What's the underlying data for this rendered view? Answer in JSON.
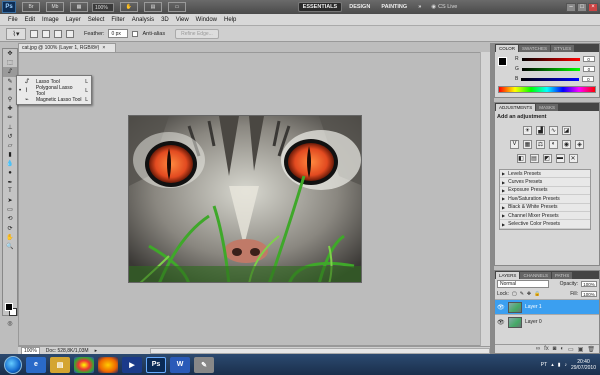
{
  "app": {
    "logo": "Ps",
    "zoom": "100%",
    "workspaces": [
      "ESSENTIALS",
      "DESIGN",
      "PAINTING"
    ],
    "more": "»",
    "cs_live": "CS Live"
  },
  "menu": [
    "File",
    "Edit",
    "Image",
    "Layer",
    "Select",
    "Filter",
    "Analysis",
    "3D",
    "View",
    "Window",
    "Help"
  ],
  "options": {
    "feather_label": "Feather:",
    "feather_value": "0 px",
    "anti_alias_label": "Anti-alias",
    "refine_edge": "Refine Edge..."
  },
  "lasso_menu": [
    {
      "label": "Lasso Tool",
      "key": "L",
      "selected": false
    },
    {
      "label": "Polygonal Lasso Tool",
      "key": "L",
      "selected": true
    },
    {
      "label": "Magnetic Lasso Tool",
      "key": "L",
      "selected": false
    }
  ],
  "document": {
    "tab_title": "cat.jpg @ 100% (Layer 1, RGB/8#)",
    "close": "×",
    "zoom": "100%",
    "doc_info": "Doc: 528,8K/1,03M"
  },
  "color_panel": {
    "tabs": [
      "COLOR",
      "SWATCHES",
      "STYLES"
    ],
    "channels": [
      {
        "label": "R",
        "value": "0",
        "color": "#e03030"
      },
      {
        "label": "G",
        "value": "0",
        "color": "#30b030"
      },
      {
        "label": "B",
        "value": "0",
        "color": "#3060e0"
      }
    ]
  },
  "adjustments": {
    "tabs": [
      "ADJUSTMENTS",
      "MASKS"
    ],
    "title": "Add an adjustment",
    "presets": [
      "Levels Presets",
      "Curves Presets",
      "Exposure Presets",
      "Hue/Saturation Presets",
      "Black & White Presets",
      "Channel Mixer Presets",
      "Selective Color Presets"
    ]
  },
  "layers_panel": {
    "tabs": [
      "LAYERS",
      "CHANNELS",
      "PATHS"
    ],
    "blend_mode": "Normal",
    "opacity_label": "Opacity:",
    "opacity": "100%",
    "lock_label": "Lock:",
    "fill_label": "Fill:",
    "fill": "100%",
    "layers": [
      {
        "name": "Layer 1",
        "selected": true
      },
      {
        "name": "Layer 0",
        "selected": false
      }
    ]
  },
  "taskbar": {
    "lang": "PT",
    "time": "20:40",
    "date": "29/07/2010"
  }
}
